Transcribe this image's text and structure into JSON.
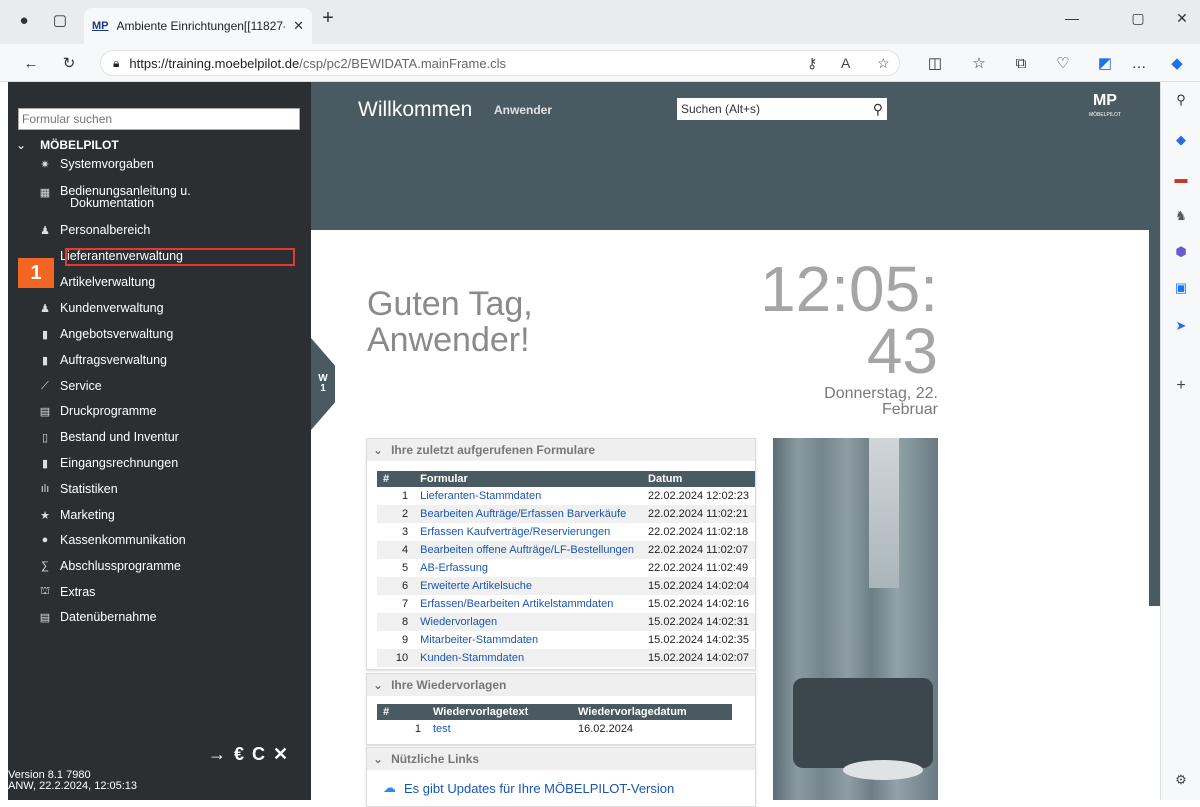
{
  "browser": {
    "tab_title": "Ambiente Einrichtungen[[11827-",
    "tab_logo": "MP",
    "url_host": "https://training.moebelpilot.de",
    "url_path": "/csp/pc2/BEWIDATA.mainFrame.cls",
    "icons": [
      "profile-icon",
      "tab-actions-icon",
      "new-tab-icon",
      "back-icon",
      "reload-icon",
      "lock-icon",
      "key-icon",
      "read-aloud-icon",
      "favorite-icon",
      "split-screen-icon",
      "favorites-icon",
      "collections-icon",
      "browser-essentials-icon",
      "copilot-icon",
      "more-icon"
    ]
  },
  "app": {
    "search_placeholder": "Formular suchen",
    "root_label": "MÖBELPILOT",
    "nav": [
      {
        "label": "Systemvorgaben",
        "icon": "gear-icon"
      },
      {
        "label": "Bedienungsanleitung u.",
        "label2": "Dokumentation",
        "icon": "book-icon"
      },
      {
        "label": "Personalbereich",
        "icon": "person-icon"
      },
      {
        "label": "Lieferantenverwaltung",
        "icon": "truck-icon"
      },
      {
        "label": "Artikelverwaltung",
        "icon": "chair-icon"
      },
      {
        "label": "Kundenverwaltung",
        "icon": "customer-icon"
      },
      {
        "label": "Angebotsverwaltung",
        "icon": "offer-icon"
      },
      {
        "label": "Auftragsverwaltung",
        "icon": "order-icon"
      },
      {
        "label": "Service",
        "icon": "wrench-icon"
      },
      {
        "label": "Druckprogramme",
        "icon": "printer-icon"
      },
      {
        "label": "Bestand und Inventur",
        "icon": "inventory-icon"
      },
      {
        "label": "Eingangsrechnungen",
        "icon": "invoice-icon"
      },
      {
        "label": "Statistiken",
        "icon": "chart-icon"
      },
      {
        "label": "Marketing",
        "icon": "star-icon"
      },
      {
        "label": "Kassenkommunikation",
        "icon": "chat-icon"
      },
      {
        "label": "Abschlussprogramme",
        "icon": "sum-icon"
      },
      {
        "label": "Extras",
        "icon": "tree-icon"
      },
      {
        "label": "Datenübernahme",
        "icon": "import-icon"
      }
    ],
    "callout_number": "1",
    "version_line1": "Version 8.1 7980",
    "version_line2": "ANW, 22.2.2024, 12:05:13",
    "tools": [
      "→",
      "€",
      "C",
      "✕"
    ]
  },
  "header": {
    "welcome": "Willkommen",
    "user": "Anwender",
    "search_placeholder": "Suchen (Alt+s)",
    "logo": "MP"
  },
  "side_tab": "W\n1",
  "greeting_line1": "Guten Tag,",
  "greeting_line2": "Anwender!",
  "clock_line1": "12:05:",
  "clock_line2": "43",
  "date_line1": "Donnerstag, 22.",
  "date_line2": "Februar",
  "recent": {
    "title": "Ihre zuletzt aufgerufenen Formulare",
    "headers": [
      "#",
      "Formular",
      "Datum"
    ],
    "rows": [
      [
        "1",
        "Lieferanten-Stammdaten",
        "22.02.2024 12:02:23"
      ],
      [
        "2",
        "Bearbeiten Aufträge/Erfassen Barverkäufe",
        "22.02.2024 11:02:21"
      ],
      [
        "3",
        "Erfassen Kaufverträge/Reservierungen",
        "22.02.2024 11:02:18"
      ],
      [
        "4",
        "Bearbeiten offene Aufträge/LF-Bestellungen",
        "22.02.2024 11:02:07"
      ],
      [
        "5",
        "AB-Erfassung",
        "22.02.2024 11:02:49"
      ],
      [
        "6",
        "Erweiterte Artikelsuche",
        "15.02.2024 14:02:04"
      ],
      [
        "7",
        "Erfassen/Bearbeiten Artikelstammdaten",
        "15.02.2024 14:02:16"
      ],
      [
        "8",
        "Wiedervorlagen",
        "15.02.2024 14:02:31"
      ],
      [
        "9",
        "Mitarbeiter-Stammdaten",
        "15.02.2024 14:02:35"
      ],
      [
        "10",
        "Kunden-Stammdaten",
        "15.02.2024 14:02:07"
      ]
    ]
  },
  "reminders": {
    "title": "Ihre Wiedervorlagen",
    "headers": [
      "#",
      "Wiedervorlagetext",
      "Wiedervorlagedatum"
    ],
    "rows": [
      [
        "1",
        "test",
        "16.02.2024"
      ]
    ]
  },
  "links": {
    "title": "Nützliche Links",
    "text": "Es gibt Updates für Ihre MÖBELPILOT-Version"
  }
}
